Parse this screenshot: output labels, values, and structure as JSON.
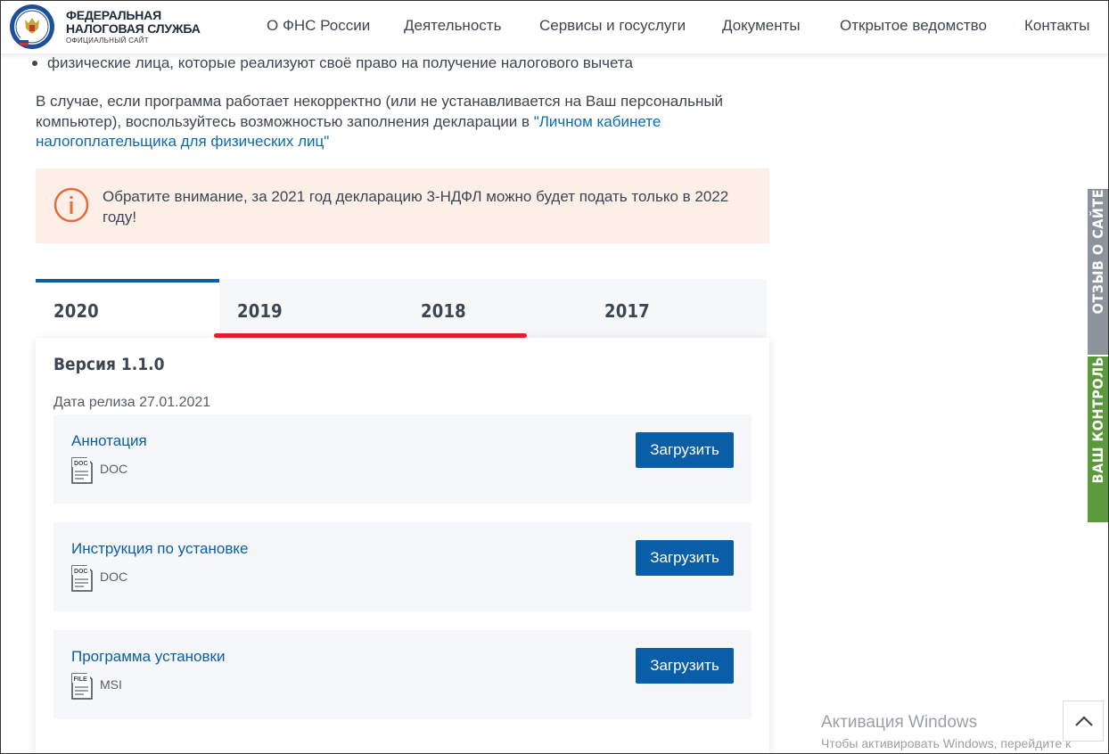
{
  "header": {
    "logo_line1": "ФЕДЕРАЛЬНАЯ",
    "logo_line2": "НАЛОГОВАЯ СЛУЖБА",
    "logo_line3": "ОФИЦИАЛЬНЫЙ САЙТ",
    "nav": [
      {
        "label": "О ФНС России"
      },
      {
        "label": "Деятельность"
      },
      {
        "label": "Сервисы и госуслуги"
      },
      {
        "label": "Документы"
      },
      {
        "label": "Открытое ведомство"
      },
      {
        "label": "Контакты"
      }
    ]
  },
  "content": {
    "bullet_text": "физические лица, которые реализуют своё право на получение налогового вычета",
    "paragraph_text": "В случае, если программа работает некорректно (или не устанавливается на Ваш персональный компьютер), воспользуйтесь возможностью заполнения декларации в ",
    "paragraph_link": "\"Личном кабинете налогоплательщика для физических лиц\"",
    "notice_text": "Обратите внимание, за 2021 год декларацию 3-НДФЛ можно будет подать только в 2022 году!"
  },
  "tabs": [
    {
      "label": "2020",
      "active": true
    },
    {
      "label": "2019",
      "active": false
    },
    {
      "label": "2018",
      "active": false
    },
    {
      "label": "2017",
      "active": false
    }
  ],
  "panel": {
    "version": "Версия 1.1.0",
    "release_date": "Дата релиза 27.01.2021",
    "files": [
      {
        "title": "Аннотация",
        "icon_label": "DOC",
        "ext": "DOC",
        "button": "Загрузить"
      },
      {
        "title": "Инструкция по установке",
        "icon_label": "DOC",
        "ext": "DOC",
        "button": "Загрузить"
      },
      {
        "title": "Программа установки",
        "icon_label": "FILE",
        "ext": "MSI",
        "button": "Загрузить"
      }
    ]
  },
  "side_tabs": {
    "feedback": "ОТЗЫВ О САЙТЕ",
    "control": "ВАШ КОНТРОЛЬ"
  },
  "windows": {
    "title": "Активация Windows",
    "subtitle": "Чтобы активировать Windows, перейдите к"
  },
  "colors": {
    "accent": "#0a5ea8",
    "notice_bg": "#fcefe8",
    "notice_icon": "#e8693a",
    "underline_red": "#d8232a",
    "side_feedback": "#8c939b",
    "side_control": "#5b9a3c"
  }
}
